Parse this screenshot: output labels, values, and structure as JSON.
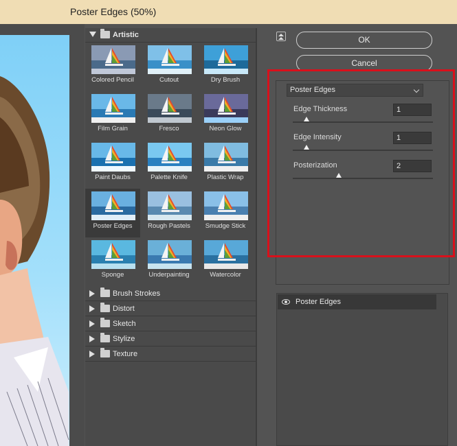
{
  "window": {
    "title": "Poster Edges (50%)"
  },
  "gallery": {
    "open_category": "Artistic",
    "filters": [
      "Colored Pencil",
      "Cutout",
      "Dry Brush",
      "Film Grain",
      "Fresco",
      "Neon Glow",
      "Paint Daubs",
      "Palette Knife",
      "Plastic Wrap",
      "Poster Edges",
      "Rough Pastels",
      "Smudge Stick",
      "Sponge",
      "Underpainting",
      "Watercolor"
    ],
    "selected_filter": "Poster Edges",
    "collapsed_categories": [
      "Brush Strokes",
      "Distort",
      "Sketch",
      "Stylize",
      "Texture"
    ]
  },
  "buttons": {
    "ok": "OK",
    "cancel": "Cancel"
  },
  "settings": {
    "filter_select": "Poster Edges",
    "params": [
      {
        "label": "Edge Thickness",
        "value": "1",
        "level": 0.1
      },
      {
        "label": "Edge Intensity",
        "value": "1",
        "level": 0.1
      },
      {
        "label": "Posterization",
        "value": "2",
        "level": 0.33
      }
    ]
  },
  "layers": [
    {
      "name": "Poster Edges",
      "visible": true
    }
  ],
  "colors": {
    "highlight": "#d9101b",
    "titlebar": "#f0ddb4",
    "panel": "#535353"
  }
}
